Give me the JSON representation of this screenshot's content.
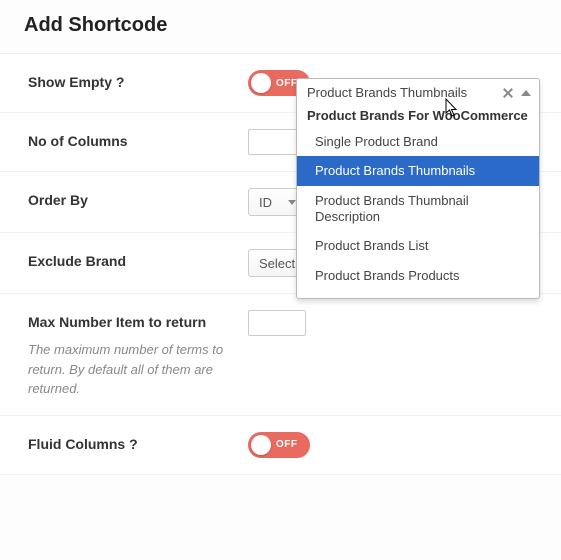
{
  "header": {
    "title": "Add Shortcode"
  },
  "fields": {
    "show_empty": {
      "label": "Show Empty ?",
      "toggle_text": "OFF"
    },
    "columns": {
      "label": "No of Columns"
    },
    "order_by": {
      "label": "Order By",
      "value": "ID"
    },
    "exclude": {
      "label": "Exclude Brand",
      "placeholder": "Select a Brand To Exclude"
    },
    "max_return": {
      "label": "Max Number Item to return",
      "desc": "The maximum number of terms to return. By default all of them are returned."
    },
    "fluid": {
      "label": "Fluid Columns ?",
      "toggle_text": "OFF"
    }
  },
  "dropdown": {
    "current": "Product Brands Thumbnails",
    "group_label": "Product Brands For WooCommerce",
    "options": [
      {
        "label": "Single Product Brand"
      },
      {
        "label": "Product Brands Thumbnails",
        "selected": true
      },
      {
        "label": "Product Brands Thumbnail Description"
      },
      {
        "label": "Product Brands List"
      },
      {
        "label": "Product Brands Products"
      }
    ]
  }
}
